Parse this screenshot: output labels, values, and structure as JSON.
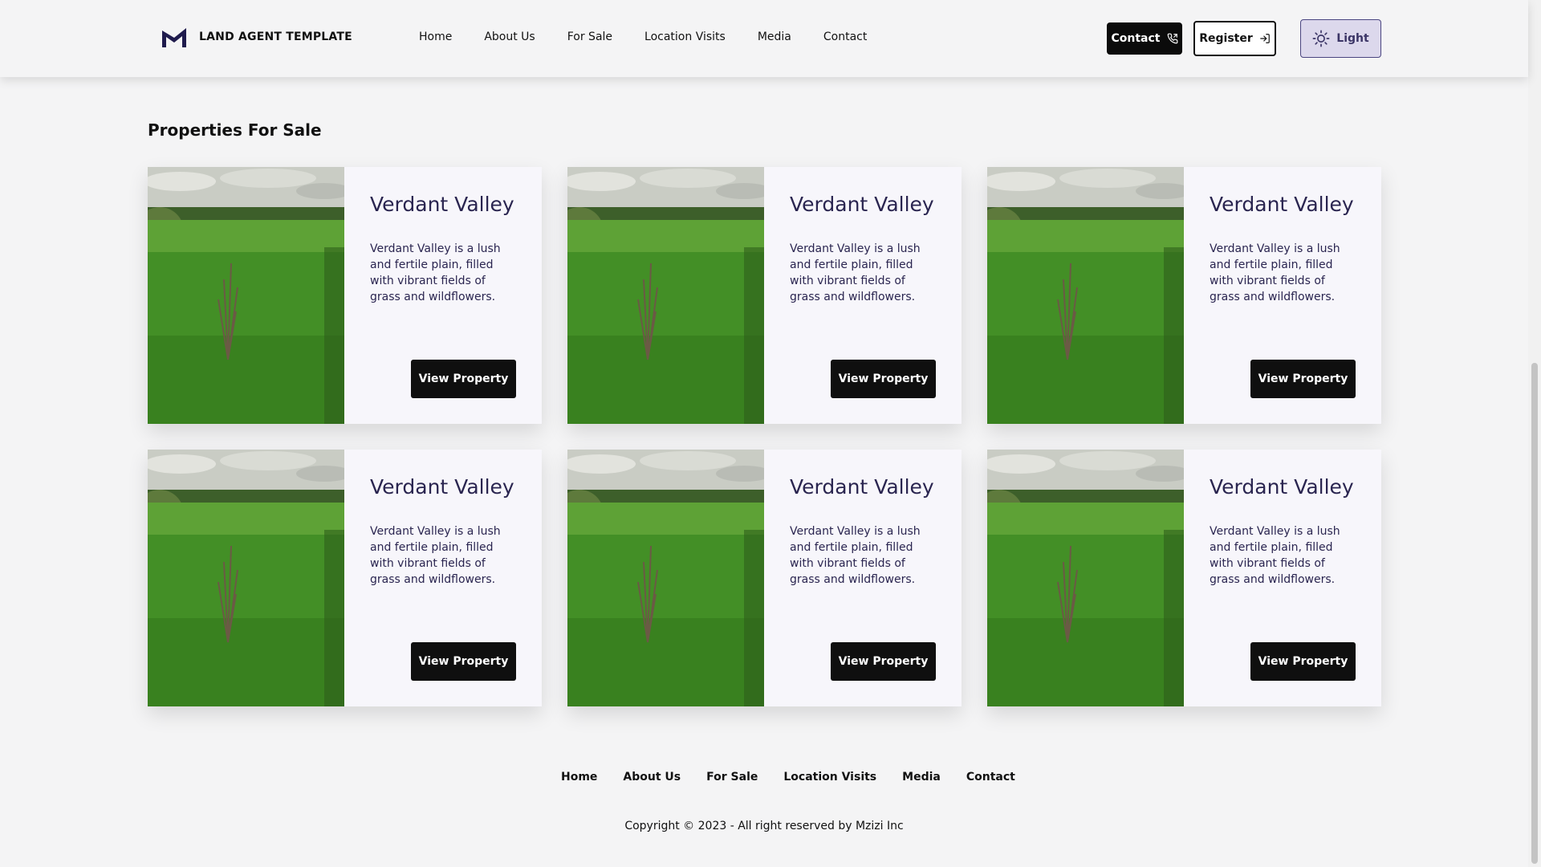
{
  "header": {
    "brand": "LAND AGENT TEMPLATE",
    "nav": [
      "Home",
      "About Us",
      "For Sale",
      "Location Visits",
      "Media",
      "Contact"
    ],
    "contact_label": "Contact",
    "register_label": "Register",
    "theme_label": "Light"
  },
  "section": {
    "title": "Properties For Sale"
  },
  "properties": [
    {
      "title": "Verdant Valley",
      "description": "Verdant Valley is a lush and fertile plain, filled with vibrant fields of grass and wildflowers.",
      "button": "View Property"
    },
    {
      "title": "Verdant Valley",
      "description": "Verdant Valley is a lush and fertile plain, filled with vibrant fields of grass and wildflowers.",
      "button": "View Property"
    },
    {
      "title": "Verdant Valley",
      "description": "Verdant Valley is a lush and fertile plain, filled with vibrant fields of grass and wildflowers.",
      "button": "View Property"
    },
    {
      "title": "Verdant Valley",
      "description": "Verdant Valley is a lush and fertile plain, filled with vibrant fields of grass and wildflowers.",
      "button": "View Property"
    },
    {
      "title": "Verdant Valley",
      "description": "Verdant Valley is a lush and fertile plain, filled with vibrant fields of grass and wildflowers.",
      "button": "View Property"
    },
    {
      "title": "Verdant Valley",
      "description": "Verdant Valley is a lush and fertile plain, filled with vibrant fields of grass and wildflowers.",
      "button": "View Property"
    }
  ],
  "footer": {
    "nav": [
      "Home",
      "About Us",
      "For Sale",
      "Location Visits",
      "Media",
      "Contact"
    ],
    "copyright": "Copyright © 2023 - All right reserved by Mzizi Inc"
  },
  "colors": {
    "primary": "#0b0b0b",
    "card_text": "#2a2550",
    "theme_button_bg": "#dcd8ec"
  },
  "icons": {
    "logo": "logo-mark-icon",
    "contact": "phone-icon",
    "register": "sign-in-icon",
    "theme": "sun-icon"
  }
}
